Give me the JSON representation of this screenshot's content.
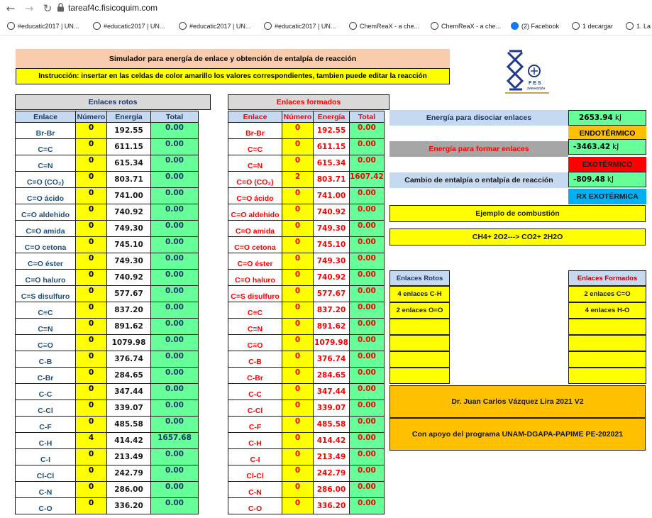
{
  "browser": {
    "url": "tareaf4c.fisicoquim.com",
    "bookmarks": [
      "#educatic2017 | UN...",
      "#educatic2017 | UN...",
      "#educatic2017 | UN...",
      "#educatic2017 | UN...",
      "ChemReaX - a che...",
      "ChemReaX - a che...",
      "(2) Facebook",
      "1 decargar",
      "1. La"
    ]
  },
  "header": {
    "title": "Simulador para energía de enlace y obtención de entalpía de reacción",
    "instruction": "Instrucción: insertar en las celdas de color amarillo los valores correspondientes, tambien puede editar la reacción"
  },
  "logo": {
    "text": "FES ZARAGOZA",
    "colors": {
      "blue": "#1f3a8a",
      "gold": "#c8a64a"
    }
  },
  "broken": {
    "heading": "Enlaces rotos",
    "columns": [
      "Enlace",
      "Número",
      "Energía",
      "Total"
    ],
    "rows": [
      [
        "Br-Br",
        "0",
        "192.55",
        "0.00"
      ],
      [
        "C=C",
        "0",
        "611.15",
        "0.00"
      ],
      [
        "C=N",
        "0",
        "615.34",
        "0.00"
      ],
      [
        "C=O (CO₂)",
        "0",
        "803.71",
        "0.00"
      ],
      [
        "C=O ácido",
        "0",
        "741.00",
        "0.00"
      ],
      [
        "C=O aldehido",
        "0",
        "740.92",
        "0.00"
      ],
      [
        "C=O amida",
        "0",
        "749.30",
        "0.00"
      ],
      [
        "C=O cetona",
        "0",
        "745.10",
        "0.00"
      ],
      [
        "C=O éster",
        "0",
        "749.30",
        "0.00"
      ],
      [
        "C=O haluro",
        "0",
        "740.92",
        "0.00"
      ],
      [
        "C=S disulfuro",
        "0",
        "577.67",
        "0.00"
      ],
      [
        "C≡C",
        "0",
        "837.20",
        "0.00"
      ],
      [
        "C≡N",
        "0",
        "891.62",
        "0.00"
      ],
      [
        "C≡O",
        "0",
        "1079.98",
        "0.00"
      ],
      [
        "C-B",
        "0",
        "376.74",
        "0.00"
      ],
      [
        "C-Br",
        "0",
        "284.65",
        "0.00"
      ],
      [
        "C-C",
        "0",
        "347.44",
        "0.00"
      ],
      [
        "C-Cl",
        "0",
        "339.07",
        "0.00"
      ],
      [
        "C-F",
        "0",
        "485.58",
        "0.00"
      ],
      [
        "C-H",
        "4",
        "414.42",
        "1657.68"
      ],
      [
        "C-I",
        "0",
        "213.49",
        "0.00"
      ],
      [
        "Cl-Cl",
        "0",
        "242.79",
        "0.00"
      ],
      [
        "C-N",
        "0",
        "286.00",
        "0.00"
      ],
      [
        "C-O",
        "0",
        "336.20",
        "0.00"
      ]
    ]
  },
  "formed": {
    "heading": "Enlaces formados",
    "columns": [
      "Enlace",
      "Número",
      "Energía",
      "Total"
    ],
    "rows": [
      [
        "Br-Br",
        "0",
        "192.55",
        "0.00"
      ],
      [
        "C=C",
        "0",
        "611.15",
        "0.00"
      ],
      [
        "C=N",
        "0",
        "615.34",
        "0.00"
      ],
      [
        "C=O (CO₂)",
        "2",
        "803.71",
        "1607.42"
      ],
      [
        "C=O ácido",
        "0",
        "741.00",
        "0.00"
      ],
      [
        "C=O aldehido",
        "0",
        "740.92",
        "0.00"
      ],
      [
        "C=O amida",
        "0",
        "749.30",
        "0.00"
      ],
      [
        "C=O cetona",
        "0",
        "745.10",
        "0.00"
      ],
      [
        "C=O éster",
        "0",
        "749.30",
        "0.00"
      ],
      [
        "C=O haluro",
        "0",
        "740.92",
        "0.00"
      ],
      [
        "C=S disulfuro",
        "0",
        "577.67",
        "0.00"
      ],
      [
        "C≡C",
        "0",
        "837.20",
        "0.00"
      ],
      [
        "C≡N",
        "0",
        "891.62",
        "0.00"
      ],
      [
        "C≡O",
        "0",
        "1079.98",
        "0.00"
      ],
      [
        "C-B",
        "0",
        "376.74",
        "0.00"
      ],
      [
        "C-Br",
        "0",
        "284.65",
        "0.00"
      ],
      [
        "C-C",
        "0",
        "347.44",
        "0.00"
      ],
      [
        "C-Cl",
        "0",
        "339.07",
        "0.00"
      ],
      [
        "C-F",
        "0",
        "485.58",
        "0.00"
      ],
      [
        "C-H",
        "0",
        "414.42",
        "0.00"
      ],
      [
        "C-I",
        "0",
        "213.49",
        "0.00"
      ],
      [
        "Cl-Cl",
        "0",
        "242.79",
        "0.00"
      ],
      [
        "C-N",
        "0",
        "286.00",
        "0.00"
      ],
      [
        "C-O",
        "0",
        "336.20",
        "0.00"
      ]
    ]
  },
  "results": {
    "dissociate_label": "Energía para disociar enlaces",
    "dissociate_value": "2653.94",
    "dissociate_unit": "kJ",
    "endothermic": "ENDOTÉRMICO",
    "form_label": "Energía para formar enlaces",
    "form_value": "-3463.42",
    "form_unit": "kJ",
    "exothermic": "EXOTÉRMICO",
    "enthalpy_label": "Cambio de entalpía o entalpía de reacción",
    "enthalpy_value": "-809.48",
    "enthalpy_unit": "kJ",
    "rx": "RX EXOTÉRMICA",
    "example_title": "Ejemplo de combustión",
    "reaction": "CH4+ 2O2---> CO2+ 2H2O"
  },
  "example_broken": {
    "heading": "Enlaces Rotos",
    "items": [
      "4 enlaces C-H",
      "2 enlaces O=O",
      "",
      "",
      "",
      ""
    ]
  },
  "example_formed": {
    "heading": "Enlaces Formados",
    "items": [
      "2 enlaces C=O",
      "4 enlaces H-O",
      "",
      "",
      "",
      ""
    ]
  },
  "credits": {
    "author": "Dr. Juan Carlos Vázquez Lira 2021 V2",
    "support": "Con apoyo del programa UNAM-DGAPA-PAPIME PE-202021"
  },
  "colors": {
    "yellow": "#ffff00",
    "green": "#66ff99",
    "orange": "#ffc000",
    "red": "#ff0000",
    "cyan": "#00b0f0",
    "peach": "#f8cbad",
    "gray": "#d9d9d9"
  }
}
